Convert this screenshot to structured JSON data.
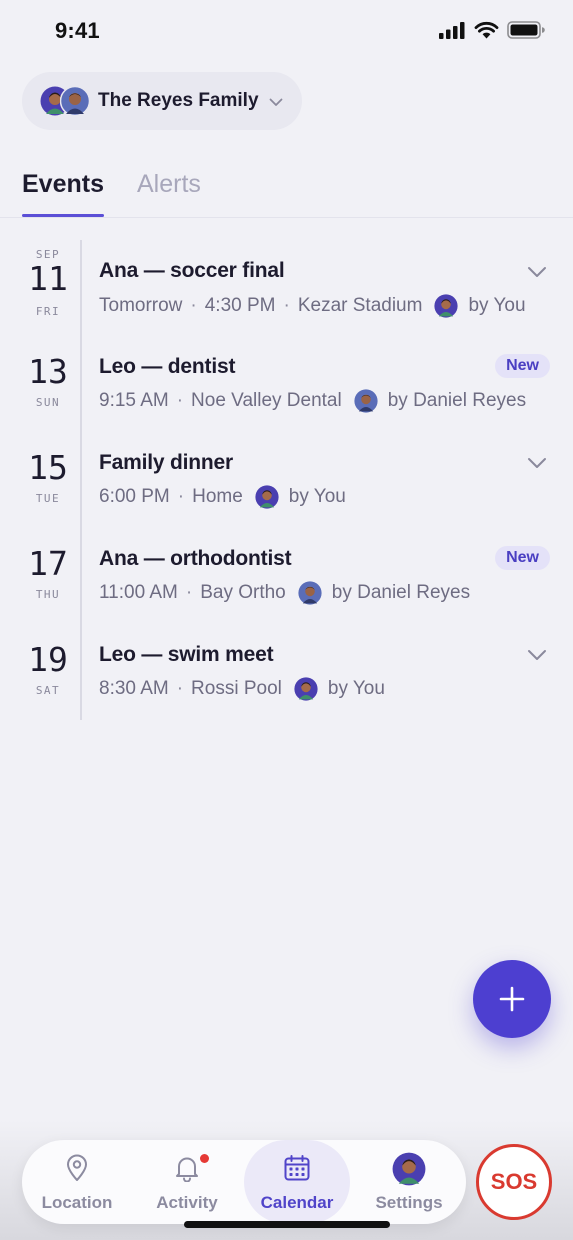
{
  "status_bar": {
    "time": "9:41"
  },
  "family": {
    "name": "The Reyes Family"
  },
  "tabs": [
    {
      "label": "Events",
      "active": true
    },
    {
      "label": "Alerts",
      "active": false
    }
  ],
  "events": [
    {
      "month": "SEP",
      "day": "11",
      "weekday": "FRI",
      "title": "Ana — soccer final",
      "when": "Tomorrow",
      "time": "4:30 PM",
      "place": "Kezar Stadium",
      "by": "by You",
      "new": false
    },
    {
      "month": "",
      "day": "13",
      "weekday": "SUN",
      "title": "Leo — dentist",
      "when": "",
      "time": "9:15 AM",
      "place": "Noe Valley Dental",
      "by": "by Daniel Reyes",
      "new": true,
      "badge": "New"
    },
    {
      "month": "",
      "day": "15",
      "weekday": "TUE",
      "title": "Family dinner",
      "when": "",
      "time": "6:00 PM",
      "place": "Home",
      "by": "by You",
      "new": false
    },
    {
      "month": "",
      "day": "17",
      "weekday": "THU",
      "title": "Ana — orthodontist",
      "when": "",
      "time": "11:00 AM",
      "place": "Bay Ortho",
      "by": "by Daniel Reyes",
      "new": true,
      "badge": "New"
    },
    {
      "month": "",
      "day": "19",
      "weekday": "SAT",
      "title": "Leo — swim meet",
      "when": "",
      "time": "8:30 AM",
      "place": "Rossi Pool",
      "by": "by You",
      "new": false
    }
  ],
  "nav": {
    "location": "Location",
    "activity": "Activity",
    "calendar": "Calendar",
    "settings": "Settings",
    "active": "calendar"
  },
  "sos": "SOS",
  "colors": {
    "accent": "#5044c9",
    "fab": "#4d3fd0",
    "sos": "#d93a30",
    "badge_bg": "#e4e2f8"
  }
}
